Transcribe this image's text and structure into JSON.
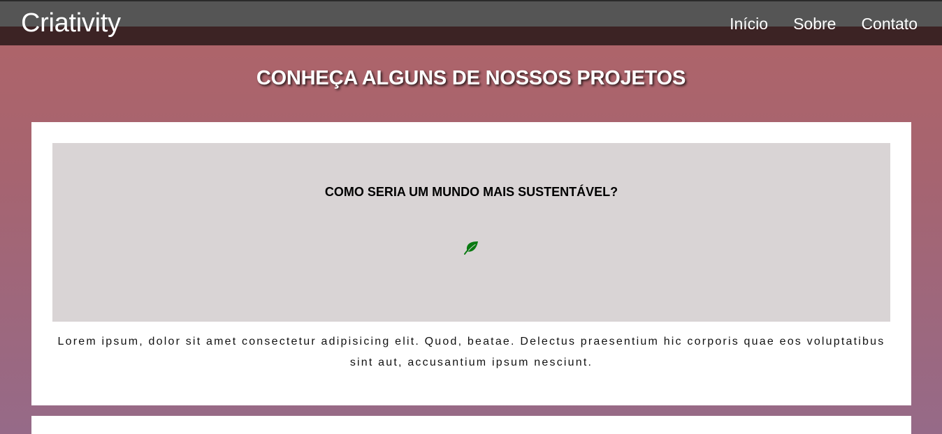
{
  "navbar": {
    "brand": "Criativity",
    "links": [
      {
        "label": "Início"
      },
      {
        "label": "Sobre"
      },
      {
        "label": "Contato"
      }
    ]
  },
  "projects": {
    "title": "CONHEÇA ALGUNS DE NOSSOS PROJETOS",
    "cards": [
      {
        "heading": "COMO SERIA UM MUNDO MAIS SUSTENTÁVEL?",
        "icon": "leaf-icon",
        "icon_color": "#0a7a12",
        "text": "Lorem ipsum, dolor sit amet consectetur adipisicing elit. Quod, beatae. Delectus praesentium hic corporis quae eos voluptatibus sint aut, accusantium ipsum nesciunt."
      }
    ]
  },
  "colors": {
    "navbar_top": "#555555",
    "navbar_bottom": "#3c2324",
    "background_top": "#b06468",
    "background_bottom": "#966a88",
    "card_background": "#ffffff",
    "media_background": "#d9d4d5"
  }
}
